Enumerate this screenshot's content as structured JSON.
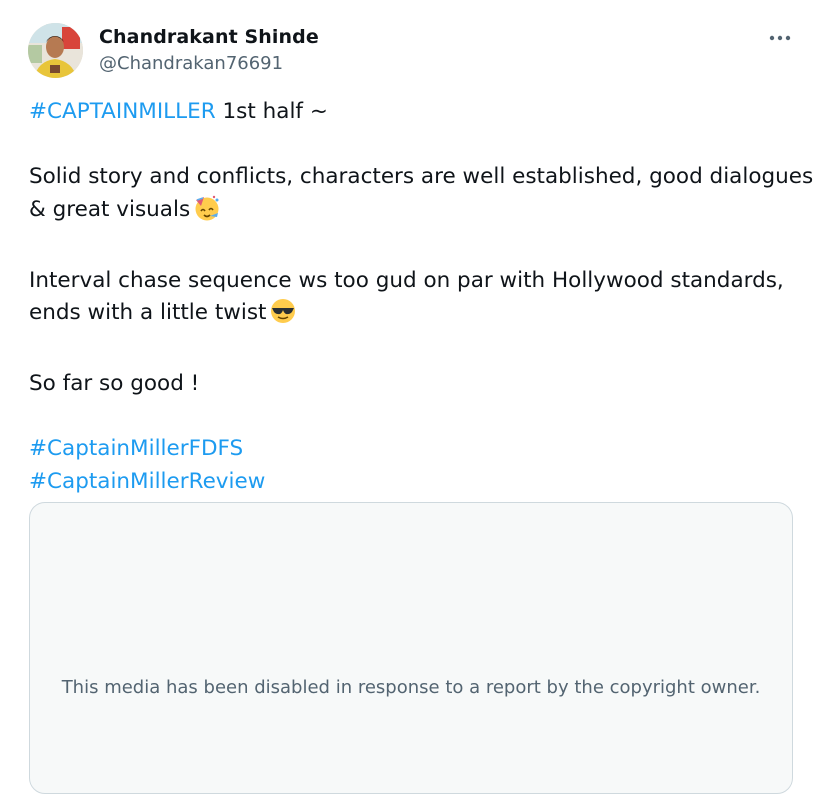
{
  "author": {
    "name": "Chandrakant Shinde",
    "handle": "@Chandrakan76691"
  },
  "more_button": {
    "icon": "more-horizontal-icon",
    "label": "•••"
  },
  "tweet": {
    "line1": {
      "hashtag": "#CAPTAINMILLER",
      "text": " 1st half ~"
    },
    "line2": "Solid story and conflicts, characters are well established, good dialogues",
    "line3": {
      "text": "& great visuals",
      "emoji": "partying-face-icon"
    },
    "line4": "Interval chase sequence ws too gud on par with Hollywood standards,",
    "line5": {
      "text": "ends with a little twist",
      "emoji": "sunglasses-face-icon"
    },
    "line6": "So far so good !",
    "hashtags": [
      "#CaptainMillerFDFS",
      "#CaptainMillerReview"
    ]
  },
  "media": {
    "notice": "This media has been disabled in response to a report by the copyright owner."
  },
  "colors": {
    "link": "#1d9bf0",
    "text": "#0f1419",
    "secondary": "#536471",
    "border": "#cfd9de",
    "media_bg": "#f7f9f9"
  }
}
